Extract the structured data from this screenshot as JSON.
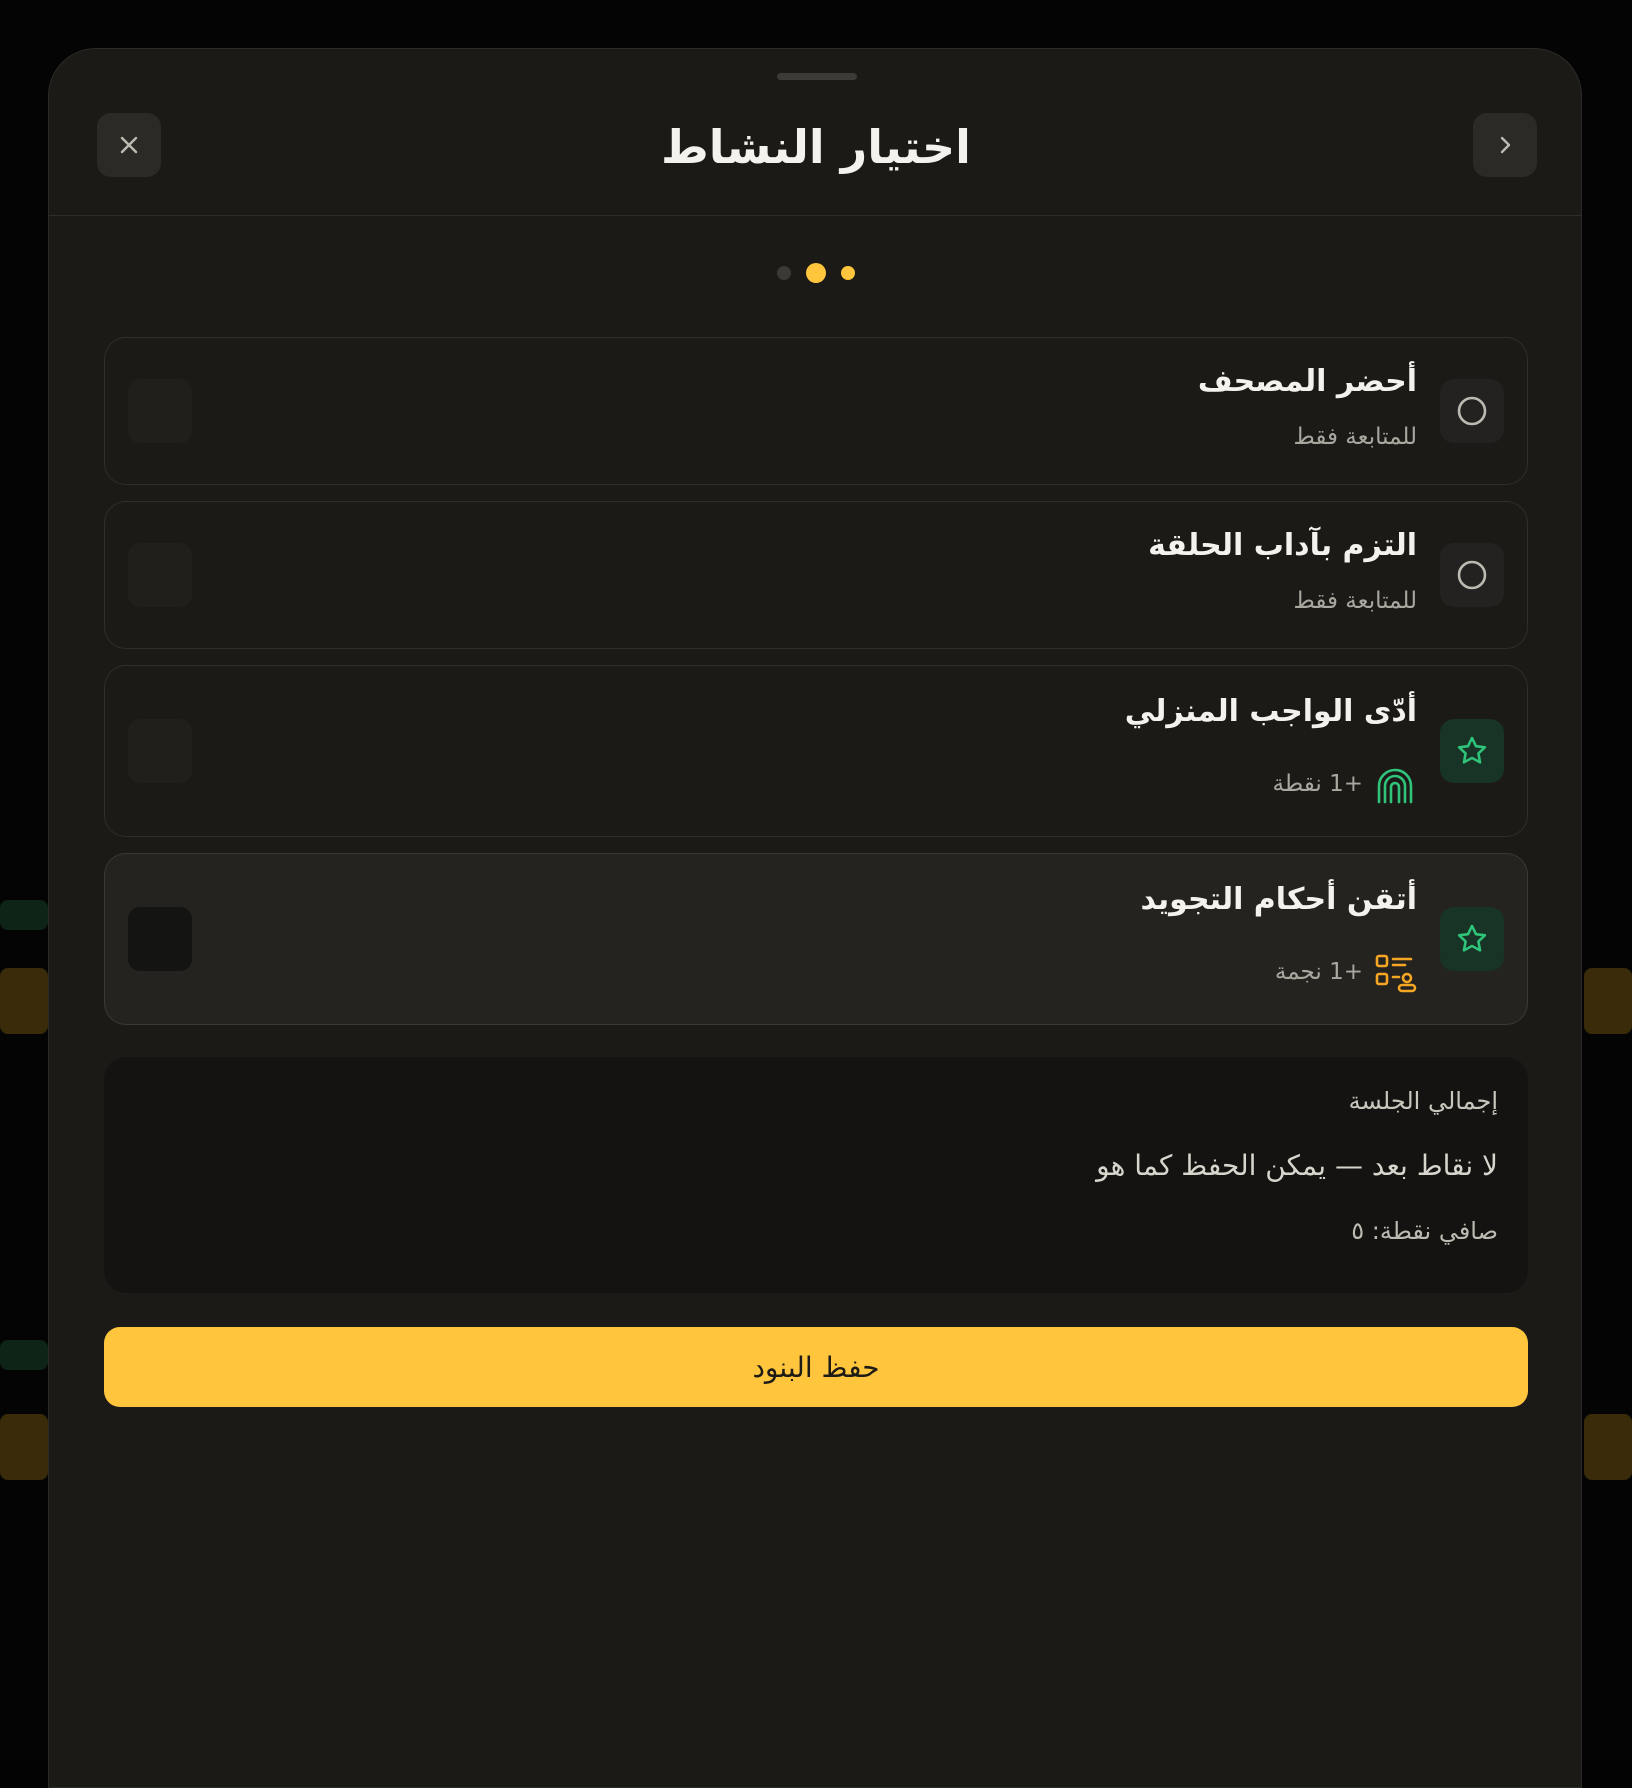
{
  "dialog": {
    "title": "اختيار النشاط",
    "pager": {
      "total": 3,
      "active": 1
    }
  },
  "activities": [
    {
      "title": "أحضر المصحف",
      "subtitle": "للمتابعة فقط",
      "reward": "",
      "status_icon": "radio-circle-icon",
      "reward_icon": ""
    },
    {
      "title": "التزم بآداب الحلقة",
      "subtitle": "للمتابعة فقط",
      "reward": "",
      "status_icon": "radio-circle-icon",
      "reward_icon": ""
    },
    {
      "title": "أدّى الواجب المنزلي",
      "subtitle": "",
      "reward": "+1 نقطة",
      "status_icon": "star-icon",
      "reward_icon": "fingerprint-icon"
    },
    {
      "title": "أتقن أحكام التجويد",
      "subtitle": "",
      "reward": "+1 نجمة",
      "status_icon": "star-icon",
      "reward_icon": "nodes-icon"
    }
  ],
  "summary": {
    "title": "إجمالي الجلسة",
    "message": "لا نقاط بعد — يمكن الحفظ كما هو",
    "net": "صافي نقطة: ٥"
  },
  "save_button": {
    "label": "حفظ البنود"
  },
  "colors": {
    "accent": "#ffc53d",
    "green": "#2fc47a",
    "orange": "#f5a623",
    "surface": "#1b1a17"
  }
}
